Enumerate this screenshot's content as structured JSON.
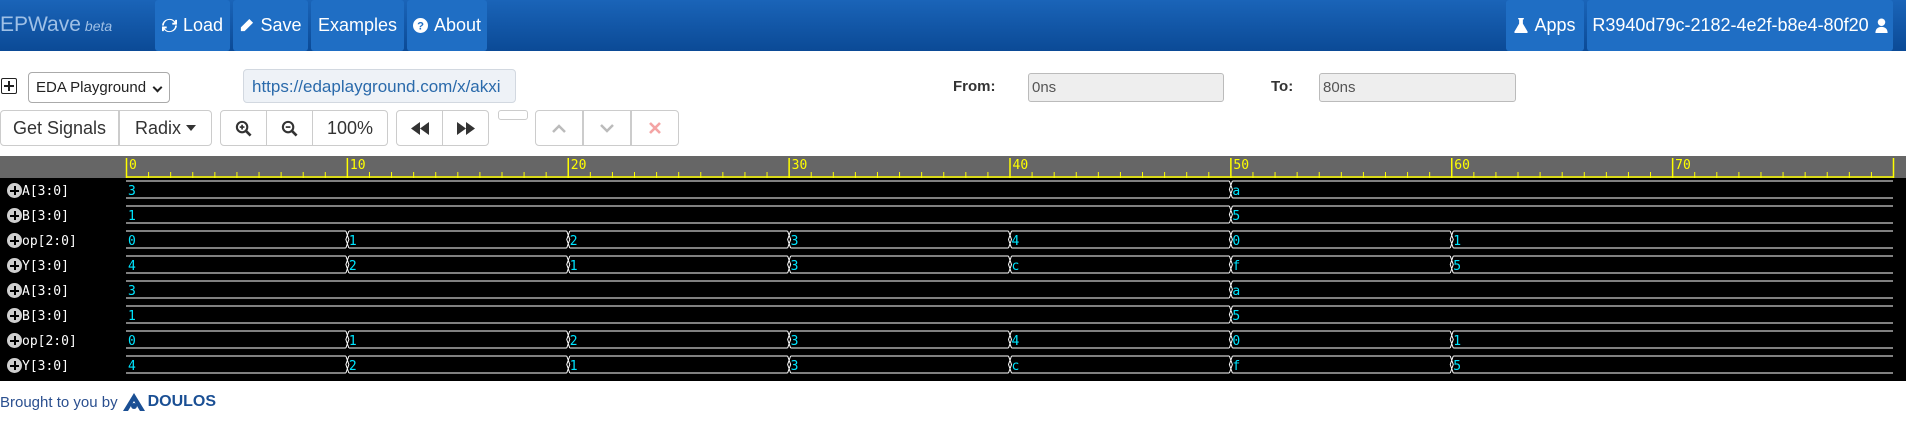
{
  "navbar": {
    "brand": "EPWave",
    "beta": "beta",
    "load": "Load",
    "save": "Save",
    "examples": "Examples",
    "about": "About",
    "apps": "Apps",
    "user": "R3940d79c-2182-4e2f-b8e4-80f20"
  },
  "controls": {
    "playground": "EDA Playground",
    "url": "https://edaplayground.com/x/akxi",
    "from_label": "From:",
    "from_value": "0ns",
    "to_label": "To:",
    "to_value": "80ns",
    "get_signals": "Get Signals",
    "radix": "Radix",
    "zoom": "100%"
  },
  "timeline": {
    "ticks": [
      "0",
      "10",
      "20",
      "30",
      "40",
      "50",
      "60",
      "70"
    ],
    "end": 80
  },
  "signals": [
    {
      "name": "A[3:0]",
      "segments": [
        {
          "t": 0,
          "v": "3"
        },
        {
          "t": 50,
          "v": "a"
        }
      ]
    },
    {
      "name": "B[3:0]",
      "segments": [
        {
          "t": 0,
          "v": "1"
        },
        {
          "t": 50,
          "v": "5"
        }
      ]
    },
    {
      "name": "op[2:0]",
      "segments": [
        {
          "t": 0,
          "v": "0"
        },
        {
          "t": 10,
          "v": "1"
        },
        {
          "t": 20,
          "v": "2"
        },
        {
          "t": 30,
          "v": "3"
        },
        {
          "t": 40,
          "v": "4"
        },
        {
          "t": 50,
          "v": "0"
        },
        {
          "t": 60,
          "v": "1"
        }
      ]
    },
    {
      "name": "Y[3:0]",
      "segments": [
        {
          "t": 0,
          "v": "4"
        },
        {
          "t": 10,
          "v": "2"
        },
        {
          "t": 20,
          "v": "1"
        },
        {
          "t": 30,
          "v": "3"
        },
        {
          "t": 40,
          "v": "c"
        },
        {
          "t": 50,
          "v": "f"
        },
        {
          "t": 60,
          "v": "5"
        }
      ]
    },
    {
      "name": "A[3:0]",
      "segments": [
        {
          "t": 0,
          "v": "3"
        },
        {
          "t": 50,
          "v": "a"
        }
      ]
    },
    {
      "name": "B[3:0]",
      "segments": [
        {
          "t": 0,
          "v": "1"
        },
        {
          "t": 50,
          "v": "5"
        }
      ]
    },
    {
      "name": "op[2:0]",
      "segments": [
        {
          "t": 0,
          "v": "0"
        },
        {
          "t": 10,
          "v": "1"
        },
        {
          "t": 20,
          "v": "2"
        },
        {
          "t": 30,
          "v": "3"
        },
        {
          "t": 40,
          "v": "4"
        },
        {
          "t": 50,
          "v": "0"
        },
        {
          "t": 60,
          "v": "1"
        }
      ]
    },
    {
      "name": "Y[3:0]",
      "segments": [
        {
          "t": 0,
          "v": "4"
        },
        {
          "t": 10,
          "v": "2"
        },
        {
          "t": 20,
          "v": "1"
        },
        {
          "t": 30,
          "v": "3"
        },
        {
          "t": 40,
          "v": "c"
        },
        {
          "t": 50,
          "v": "f"
        },
        {
          "t": 60,
          "v": "5"
        }
      ]
    }
  ],
  "footer": {
    "text": "Brought to you by",
    "logo": "DOULOS"
  },
  "colors": {
    "navbar": "#0b4a96",
    "wave_bg": "#000000",
    "wave_line": "#ffffff",
    "wave_value": "#00e5ff",
    "timeline_bg": "#666666",
    "timeline_ticks": "#ffff00"
  }
}
